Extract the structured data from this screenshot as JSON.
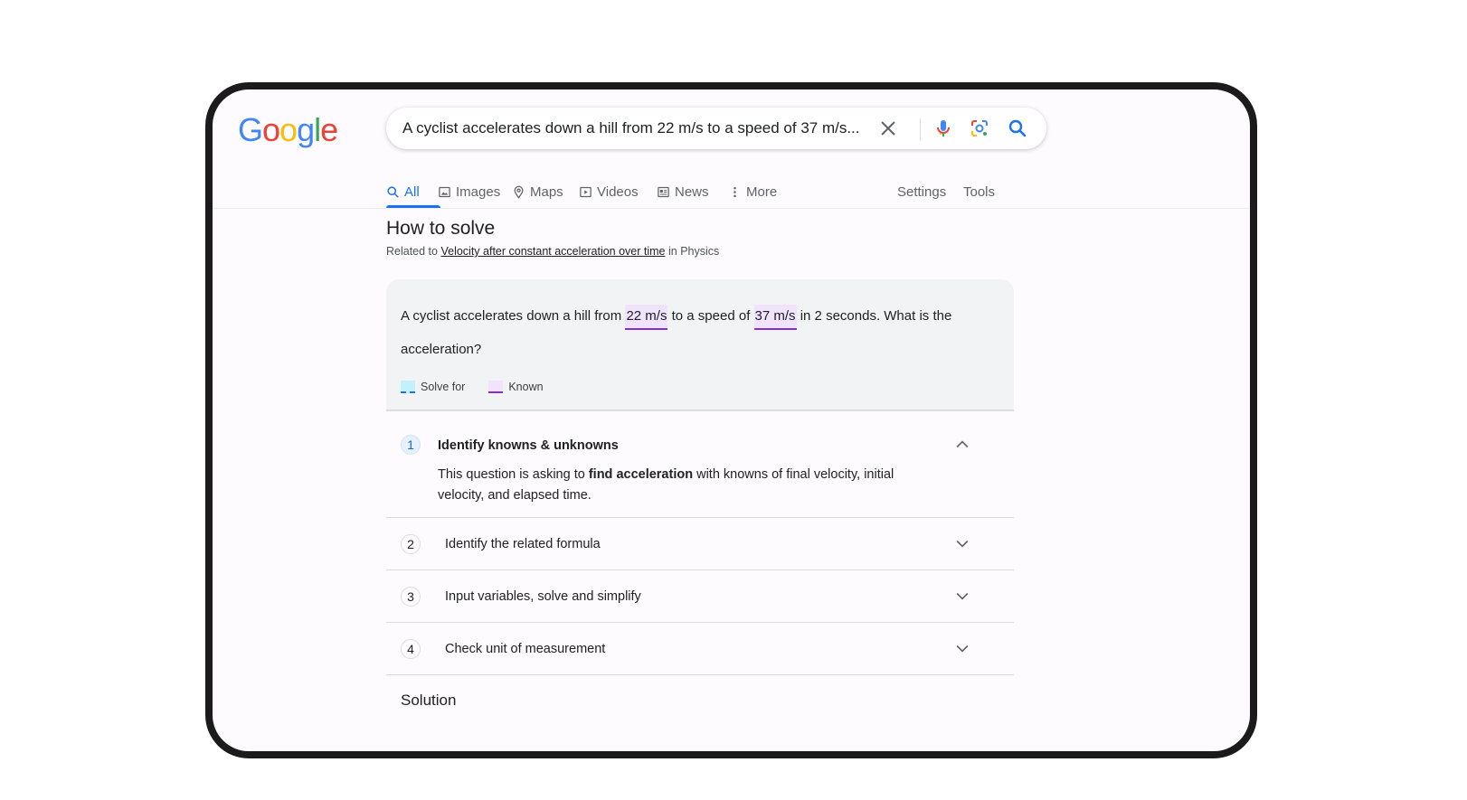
{
  "header": {
    "logo_letters": [
      {
        "ch": "G",
        "color": "#4285F4"
      },
      {
        "ch": "o",
        "color": "#EA4335"
      },
      {
        "ch": "o",
        "color": "#FBBC05"
      },
      {
        "ch": "g",
        "color": "#4285F4"
      },
      {
        "ch": "l",
        "color": "#34A853"
      },
      {
        "ch": "e",
        "color": "#EA4335"
      }
    ],
    "logo_text": "Google",
    "search_query": "A cyclist accelerates down a hill from 22 m/s to a speed of 37 m/s...",
    "icons": [
      "close-icon",
      "microphone-icon",
      "lens-icon",
      "search-icon"
    ]
  },
  "tabs": [
    {
      "label": "All",
      "icon": "search-icon",
      "active": true
    },
    {
      "label": "Images",
      "icon": "image-icon",
      "active": false
    },
    {
      "label": "Maps",
      "icon": "map-pin-icon",
      "active": false
    },
    {
      "label": "Videos",
      "icon": "video-icon",
      "active": false
    },
    {
      "label": "News",
      "icon": "news-icon",
      "active": false
    },
    {
      "label": "More",
      "icon": "more-vertical-icon",
      "active": false
    }
  ],
  "tools": {
    "settings": "Settings",
    "tools": "Tools"
  },
  "howto": {
    "title": "How to solve",
    "related_prefix": "Related to",
    "related_link": "Velocity after constant acceleration over time",
    "related_suffix": "in Physics"
  },
  "problem": {
    "part1": "A cyclist accelerates down a hill from",
    "known1": "22 m/s",
    "part2": "to a speed of",
    "known2": "37 m/s",
    "part3": "in 2 seconds. What is the acceleration?",
    "legend_solve": "Solve for",
    "legend_known": "Known",
    "colors": {
      "known_bg": "#f1e3fb",
      "known_line": "#8430ce",
      "solve_bg": "#c4f0fb",
      "solve_line": "#1a73e8"
    }
  },
  "steps": [
    {
      "num": "1",
      "title": "Identify knowns & unknowns",
      "expanded": true,
      "body_prefix": "This question is asking to",
      "body_bold": "find acceleration",
      "body_suffix": "with knowns of final velocity, initial velocity, and elapsed time."
    },
    {
      "num": "2",
      "title": "Identify the related formula",
      "expanded": false
    },
    {
      "num": "3",
      "title": "Input variables, solve and simplify",
      "expanded": false
    },
    {
      "num": "4",
      "title": "Check unit of measurement",
      "expanded": false
    }
  ],
  "solution_label": "Solution"
}
